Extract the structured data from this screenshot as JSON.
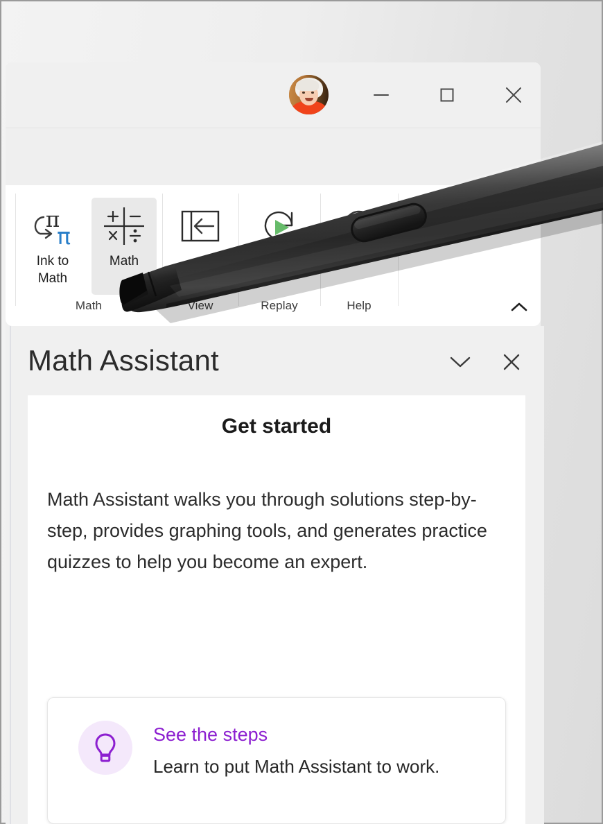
{
  "window": {
    "titlebar": {
      "avatar": {
        "name": "user-avatar",
        "alt": "User profile picture"
      },
      "buttons": [
        {
          "name": "minimize-button",
          "label": "Minimize",
          "glyph": "minimize-icon"
        },
        {
          "name": "maximize-button",
          "label": "Maximize",
          "glyph": "maximize-icon"
        },
        {
          "name": "close-button",
          "label": "Close",
          "glyph": "close-icon"
        }
      ]
    }
  },
  "ribbon": {
    "groups": [
      {
        "label": "Math",
        "buttons": [
          {
            "label": "Ink to Math",
            "label_line1": "Ink to",
            "label_line2": "Math",
            "icon": "ink-to-math-icon",
            "selected": false
          },
          {
            "label": "Math",
            "label_line1": "Math",
            "label_line2": "",
            "icon": "math-operators-icon",
            "selected": true
          }
        ]
      },
      {
        "label": "View",
        "buttons": [
          {
            "label": "",
            "label_line1": "",
            "label_line2": "",
            "icon": "dock-to-left-icon",
            "selected": false
          }
        ]
      },
      {
        "label": "Replay",
        "buttons": [
          {
            "label": "Replay",
            "label_line1": "Replay",
            "label_line2": "",
            "icon": "replay-icon",
            "selected": false
          }
        ]
      },
      {
        "label": "Help",
        "buttons": [
          {
            "label": "",
            "label_line1": "",
            "label_line2": "",
            "icon": "help-icon",
            "selected": false
          }
        ]
      }
    ],
    "collapse_button": {
      "name": "collapse-ribbon-button",
      "glyph": "chevron-up-icon",
      "label": "Collapse the Ribbon"
    }
  },
  "task_pane": {
    "title": "Math Assistant",
    "collapse_button": {
      "glyph": "chevron-down-icon",
      "label": "Collapse"
    },
    "close_button": {
      "glyph": "close-icon",
      "label": "Close"
    },
    "content": {
      "heading": "Get started",
      "body": "Math Assistant walks you through solutions step-by-step, provides graphing tools, and generates practice quizzes to help you become an expert.",
      "tip_card": {
        "icon": "lightbulb-icon",
        "title": "See the steps",
        "subtitle": "Learn to put Math Assistant to work."
      }
    }
  },
  "overlay": {
    "stylus": {
      "name": "surface-slim-pen",
      "color": "#2b2b2b",
      "button_color": "#232323"
    }
  },
  "colors": {
    "accent_purple": "#8c1fd0",
    "tip_icon_bg": "#f4e8fb",
    "ink_blue": "#2a7fc9",
    "replay_green": "#66bb6a",
    "window_chrome": "#f0f0f0",
    "ribbon_bg": "#ffffff",
    "selected_button_bg": "#e9e9e9"
  }
}
